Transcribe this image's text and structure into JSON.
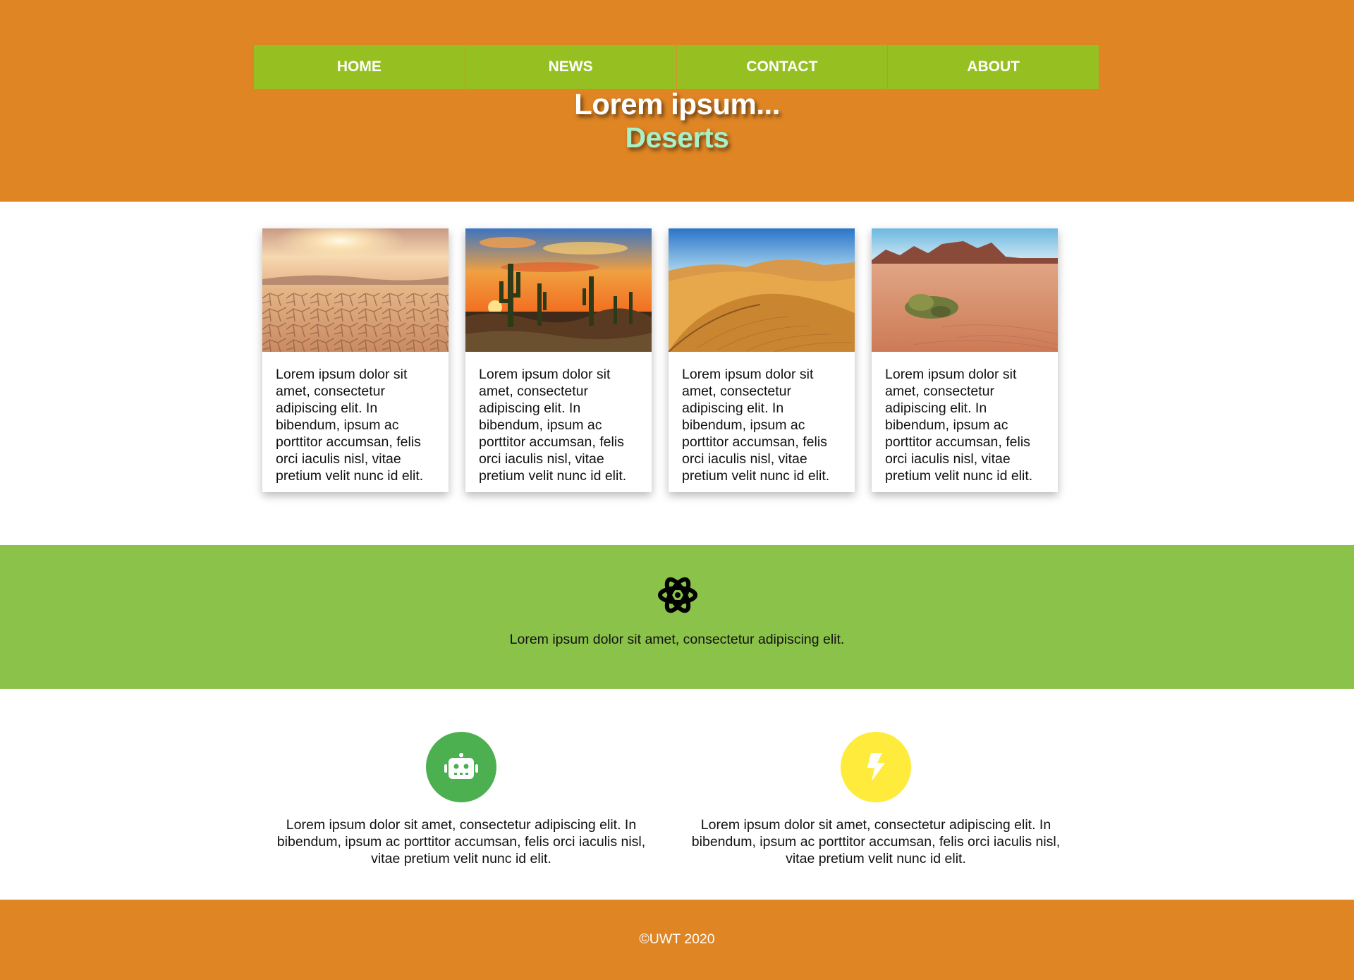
{
  "nav": {
    "items": [
      {
        "label": "HOME"
      },
      {
        "label": "NEWS"
      },
      {
        "label": "CONTACT"
      },
      {
        "label": "ABOUT"
      }
    ]
  },
  "hero": {
    "title": "Lorem ipsum...",
    "subtitle": "Deserts"
  },
  "cards": [
    {
      "image": "cracked-desert-sunset-photo",
      "text": "Lorem ipsum dolor sit amet, consectetur adipiscing elit. In bibendum, ipsum ac porttitor accumsan, felis orci iaculis nisl, vitae pretium velit nunc id elit."
    },
    {
      "image": "cactus-sunset-photo",
      "text": "Lorem ipsum dolor sit amet, consectetur adipiscing elit. In bibendum, ipsum ac porttitor accumsan, felis orci iaculis nisl, vitae pretium velit nunc id elit."
    },
    {
      "image": "sand-dunes-photo",
      "text": "Lorem ipsum dolor sit amet, consectetur adipiscing elit. In bibendum, ipsum ac porttitor accumsan, felis orci iaculis nisl, vitae pretium velit nunc id elit."
    },
    {
      "image": "red-desert-mountains-photo",
      "text": "Lorem ipsum dolor sit amet, consectetur adipiscing elit. In bibendum, ipsum ac porttitor accumsan, felis orci iaculis nisl, vitae pretium velit nunc id elit."
    }
  ],
  "band": {
    "icon": "atom-icon",
    "text": "Lorem ipsum dolor sit amet, consectetur adipiscing elit."
  },
  "features": [
    {
      "icon": "robot-icon",
      "color": "#4caf50",
      "text": "Lorem ipsum dolor sit amet, consectetur adipiscing elit. In bibendum, ipsum ac porttitor accumsan, felis orci iaculis nisl, vitae pretium velit nunc id elit."
    },
    {
      "icon": "lightning-bolt-icon",
      "color": "#ffeb3b",
      "text": "Lorem ipsum dolor sit amet, consectetur adipiscing elit. In bibendum, ipsum ac porttitor accumsan, felis orci iaculis nisl, vitae pretium velit nunc id elit."
    }
  ],
  "footer": {
    "text": "©UWT 2020"
  },
  "colors": {
    "header": "#df8524",
    "nav": "#96c022",
    "band": "#8bc34a",
    "subtitle": "#a7f0c8"
  }
}
